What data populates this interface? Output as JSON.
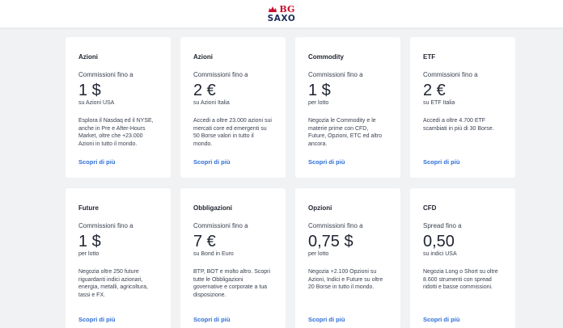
{
  "brand": {
    "top": "BG",
    "bottom": "SAXO"
  },
  "colors": {
    "brand_red": "#c8102e",
    "brand_navy": "#1c2d5a",
    "link": "#2f6fd6",
    "background": "#f1f2f4"
  },
  "cards": [
    {
      "title": "Azioni",
      "label": "Commissioni fino a",
      "value": "1 $",
      "unit": "su Azioni USA",
      "desc": "Esplora il Nasdaq ed il NYSE, anche in Pre e After-Hours Market, oltre che +23.000 Azioni in tutto il mondo.",
      "link": "Scopri di più"
    },
    {
      "title": "Azioni",
      "label": "Commissioni fino a",
      "value": "2 €",
      "unit": "su Azioni Italia",
      "desc": "Accedi a oltre 23.000 azioni sui mercati core ed emergenti su 50 Borse valori in tutto il mondo.",
      "link": "Scopri di più"
    },
    {
      "title": "Commodity",
      "label": "Commissioni fino a",
      "value": "1 $",
      "unit": "per lotto",
      "desc": "Negozia le Commodity e le materie prime con CFD, Future, Opzioni, ETC ed altro ancora.",
      "link": "Scopri di più"
    },
    {
      "title": "ETF",
      "label": "Commissioni fino a",
      "value": "2 €",
      "unit": "su ETF Italia",
      "desc": "Accedi a oltre 4.700 ETF scambiati in più di 30 Borse.",
      "link": "Scopri di più"
    },
    {
      "title": "Future",
      "label": "Commissioni fino a",
      "value": "1 $",
      "unit": "per lotto",
      "desc": "Negozia oltre 250 future riguardanti indici azionari, energia, metalli, agricoltura, tassi e FX.",
      "link": "Scopri di più"
    },
    {
      "title": "Obbligazioni",
      "label": "Commissioni fino a",
      "value": "7 €",
      "unit": "su Bond in Euro",
      "desc": "BTP, BOT e molto altro. Scopri tutte le Obbligazioni governative e corporate a tua disposizione.",
      "link": "Scopri di più"
    },
    {
      "title": "Opzioni",
      "label": "Commissioni fino a",
      "value": "0,75 $",
      "unit": "per lotto",
      "desc": "Negozia +2.100 Opzioni su Azioni, Indici e Future su oltre 20 Borse in tutto il mondo.",
      "link": "Scopri di più"
    },
    {
      "title": "CFD",
      "label": "Spread fino a",
      "value": "0,50",
      "unit": "su indici USA",
      "desc": "Negozia Long o Short su oltre 8.600 strumenti con spread ridotti e basse commissioni.",
      "link": "Scopri di più"
    }
  ]
}
